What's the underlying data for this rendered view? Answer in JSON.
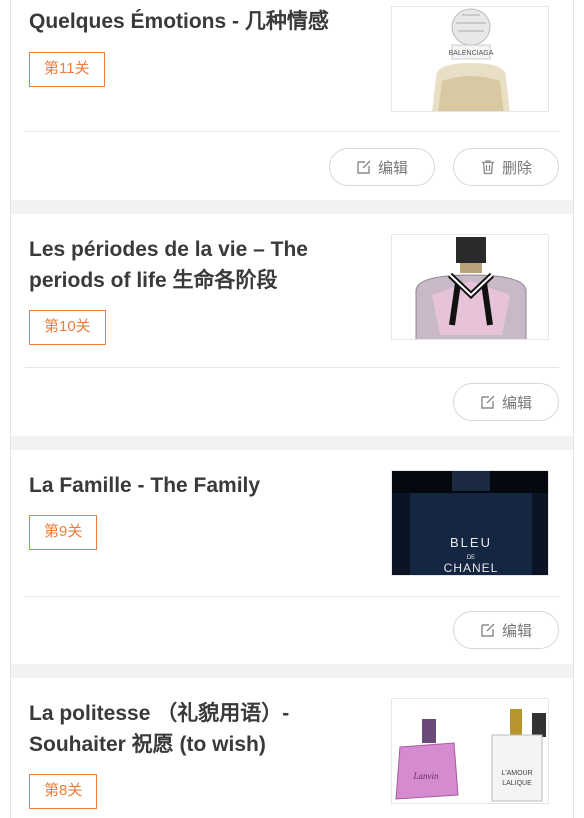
{
  "cards": [
    {
      "title": "Quelques Émotions - 几种情感",
      "level": "第11关",
      "image_label": "BALENCIAGA",
      "actions": {
        "edit": "编辑",
        "delete": "删除"
      }
    },
    {
      "title": "Les périodes de la vie – The periods of life 生命各阶段",
      "level": "第10关",
      "actions": {
        "edit": "编辑"
      }
    },
    {
      "title": "La Famille - The Family",
      "level": "第9关",
      "image_label": {
        "line1": "BLEU",
        "line2": "DE",
        "line3": "CHANEL"
      },
      "actions": {
        "edit": "编辑"
      }
    },
    {
      "title": "La politesse （礼貌用语）- Souhaiter 祝愿 (to wish)",
      "level": "第8关",
      "image_label": {
        "left": "Lanvin",
        "right_line1": "L'AMOUR",
        "right_line2": "LALIQUE"
      }
    }
  ],
  "colors": {
    "accent": "#f07c3c",
    "divider": "#e6e6e6",
    "section_gap": "#f2f2f2"
  }
}
